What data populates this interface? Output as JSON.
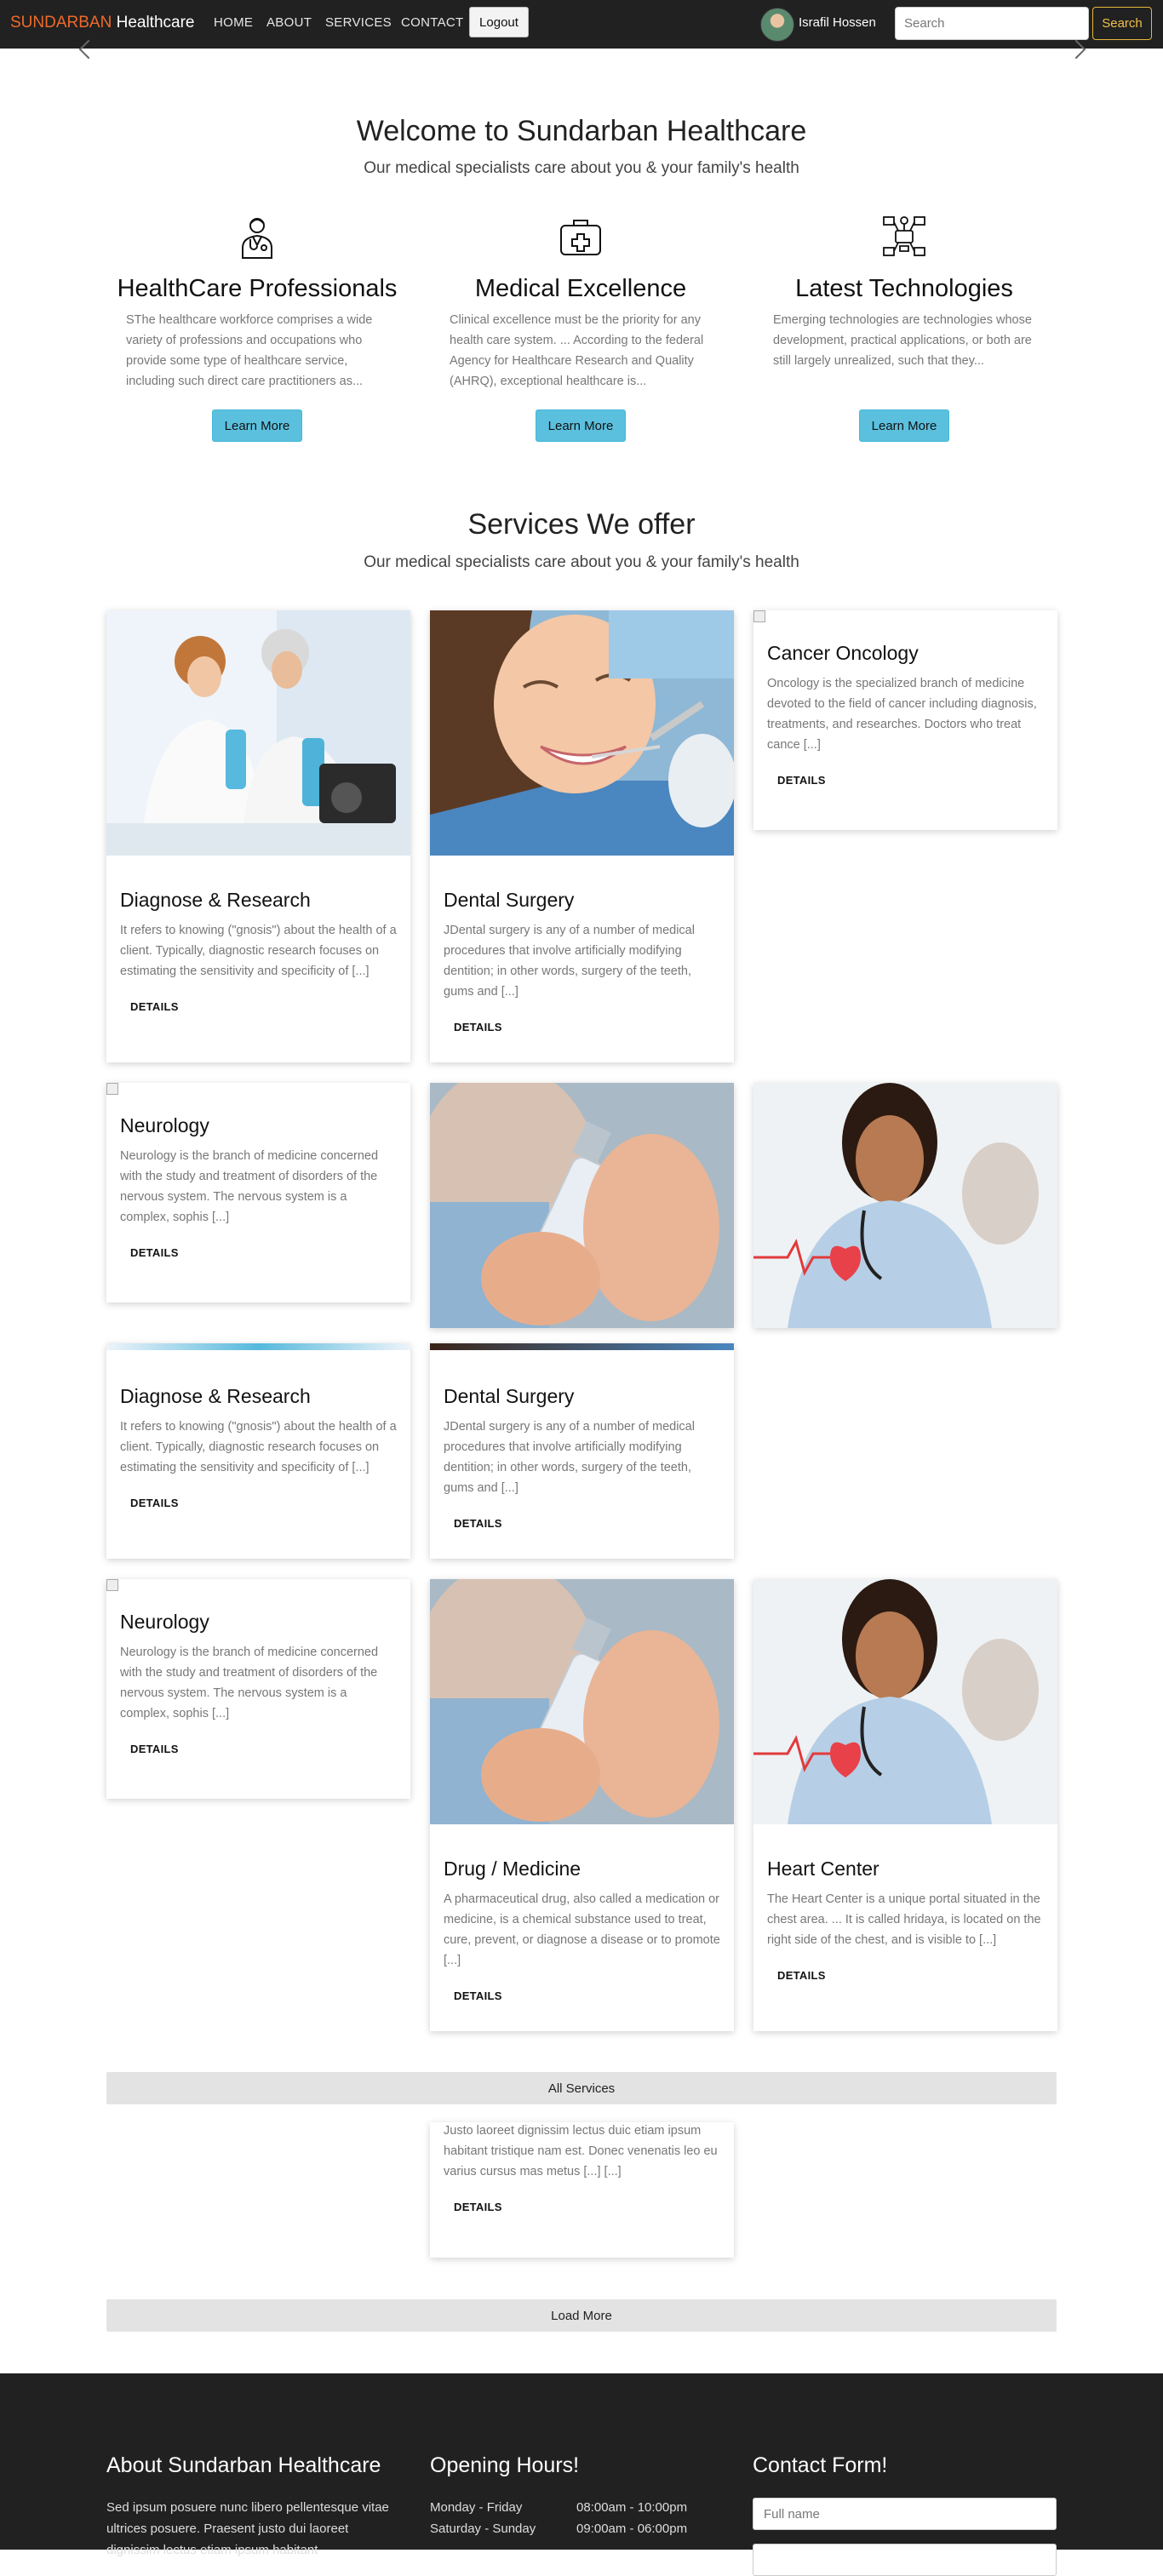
{
  "navbar": {
    "brand_first": "SUNDARBAN",
    "brand_second": "Healthcare",
    "links": [
      "HOME",
      "ABOUT",
      "SERVICES",
      "CONTACT"
    ],
    "logout_label": "Logout",
    "user_name": "Israfil Hossen",
    "search_placeholder": "Search",
    "search_button": "Search"
  },
  "welcome": {
    "title": "Welcome to Sundarban Healthcare",
    "subtitle": "Our medical specialists care about you & your family's health",
    "features": [
      {
        "icon": "doctor-icon",
        "title": "HealthCare Professionals",
        "desc": "SThe healthcare workforce comprises a wide variety of professions and occupations who provide some type of healthcare service, including such direct care practitioners as...",
        "button": "Learn More"
      },
      {
        "icon": "medical-kit-icon",
        "title": "Medical Excellence",
        "desc": "Clinical excellence must be the priority for any health care system. ... According to the federal Agency for Healthcare Research and Quality (AHRQ), exceptional healthcare is...",
        "button": "Learn More"
      },
      {
        "icon": "technology-network-icon",
        "title": "Latest Technologies",
        "desc": "Emerging technologies are technologies whose development, practical applications, or both are still largely unrealized, such that they...",
        "button": "Learn More"
      }
    ]
  },
  "services": {
    "title": "Services We offer",
    "subtitle": "Our medical specialists care about you & your family's health",
    "details_label": "DETAILS",
    "cards": {
      "diagnose": {
        "title": "Diagnose & Research",
        "desc": "It refers to knowing (\"gnosis\") about the health of a client. Typically, diagnostic research focuses on estimating the sensitivity and specificity of [...]"
      },
      "dental": {
        "title": "Dental Surgery",
        "desc": "JDental surgery is any of a number of medical procedures that involve artificially modifying dentition; in other words, surgery of the teeth, gums and [...]"
      },
      "oncology": {
        "title": "Cancer Oncology",
        "desc": "Oncology is the specialized branch of medicine devoted to the field of cancer including diagnosis, treatments, and researches. Doctors who treat cance [...]"
      },
      "neurology": {
        "title": "Neurology",
        "desc": "Neurology is the branch of medicine concerned with the study and treatment of disorders of the nervous system. The nervous system is a complex, sophis [...]"
      },
      "drug": {
        "title": "Drug / Medicine",
        "desc": "A pharmaceutical drug, also called a medication or medicine, is a chemical substance used to treat, cure, prevent, or diagnose a disease or to promote [...]"
      },
      "heart": {
        "title": "Heart Center",
        "desc": "The Heart Center is a unique portal situated in the chest area. ... It is called hridaya, is located on the right side of the chest, and is visible to [...]"
      },
      "partial": {
        "desc": "Justo laoreet dignissim lectus duic etiam ipsum habitant tristique nam est. Donec venenatis leo eu varius cursus mas metus [...] [...]"
      }
    },
    "all_services_label": "All Services",
    "load_more_label": "Load More"
  },
  "footer": {
    "about_title": "About Sundarban Healthcare",
    "about_text": "Sed ipsum posuere nunc libero pellentesque vitae ultrices posuere. Praesent justo dui laoreet dignissim lectus etiam ipsum habitant",
    "hours_title": "Opening Hours!",
    "hours": [
      {
        "day": "Monday - Friday",
        "time": "08:00am - 10:00pm"
      },
      {
        "day": "Saturday - Sunday",
        "time": "09:00am - 06:00pm"
      }
    ],
    "contact_title": "Contact Form!",
    "fullname_placeholder": "Full name"
  },
  "colors": {
    "navbar_bg": "#212121",
    "brand_accent": "#ef6a2a",
    "learn_more_button": "#5bc0de",
    "search_button_border": "#e7b73a",
    "wide_button_bg": "#e3e3e3"
  }
}
